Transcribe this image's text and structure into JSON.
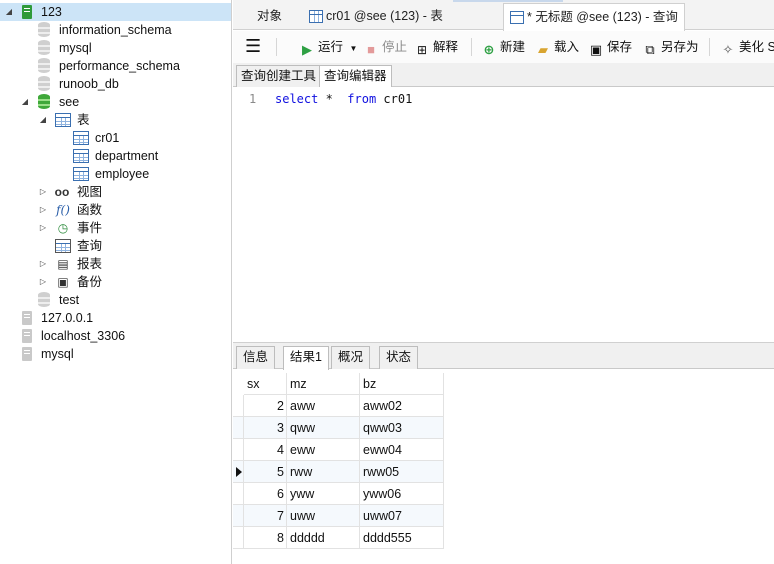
{
  "tree": {
    "connection": "123",
    "databases": [
      "information_schema",
      "mysql",
      "performance_schema",
      "runoob_db"
    ],
    "open_db": "see",
    "tables_folder": "表",
    "tables": [
      "cr01",
      "department",
      "employee"
    ],
    "views": "视图",
    "functions": "函数",
    "events": "事件",
    "queries": "查询",
    "reports": "报表",
    "backups": "备份",
    "test_db": "test",
    "connections": [
      "127.0.0.1",
      "localhost_3306",
      "mysql"
    ]
  },
  "tabs": [
    {
      "label": "对象"
    },
    {
      "label": "cr01 @see (123) - 表"
    },
    {
      "label": "* 无标题 @see (123) - 查询"
    }
  ],
  "toolbar": {
    "run": "运行",
    "stop": "停止",
    "explain": "解释",
    "new": "新建",
    "load": "载入",
    "save": "保存",
    "save_as": "另存为",
    "beautify": "美化 S"
  },
  "subtabs": [
    "查询创建工具",
    "查询编辑器"
  ],
  "editor": {
    "line_no": "1",
    "kw1": "select",
    "star": "*",
    "kw2": "from",
    "ident": "cr01"
  },
  "result_tabs": [
    "信息",
    "结果1",
    "概况",
    "状态"
  ],
  "grid": {
    "columns": [
      "sx",
      "mz",
      "bz"
    ],
    "rows": [
      [
        "2",
        "aww",
        "aww02"
      ],
      [
        "3",
        "qww",
        "qww03"
      ],
      [
        "4",
        "eww",
        "eww04"
      ],
      [
        "5",
        "rww",
        "rww05"
      ],
      [
        "6",
        "yww",
        "yww06"
      ],
      [
        "7",
        "uww",
        "uww07"
      ],
      [
        "8",
        "ddddd",
        "dddd555"
      ]
    ],
    "current_row": 3
  },
  "colors": {
    "selection": "#cce4f7",
    "keyword": "#1010e0",
    "run_green": "#2ea043",
    "db_green": "#3fa83a"
  }
}
